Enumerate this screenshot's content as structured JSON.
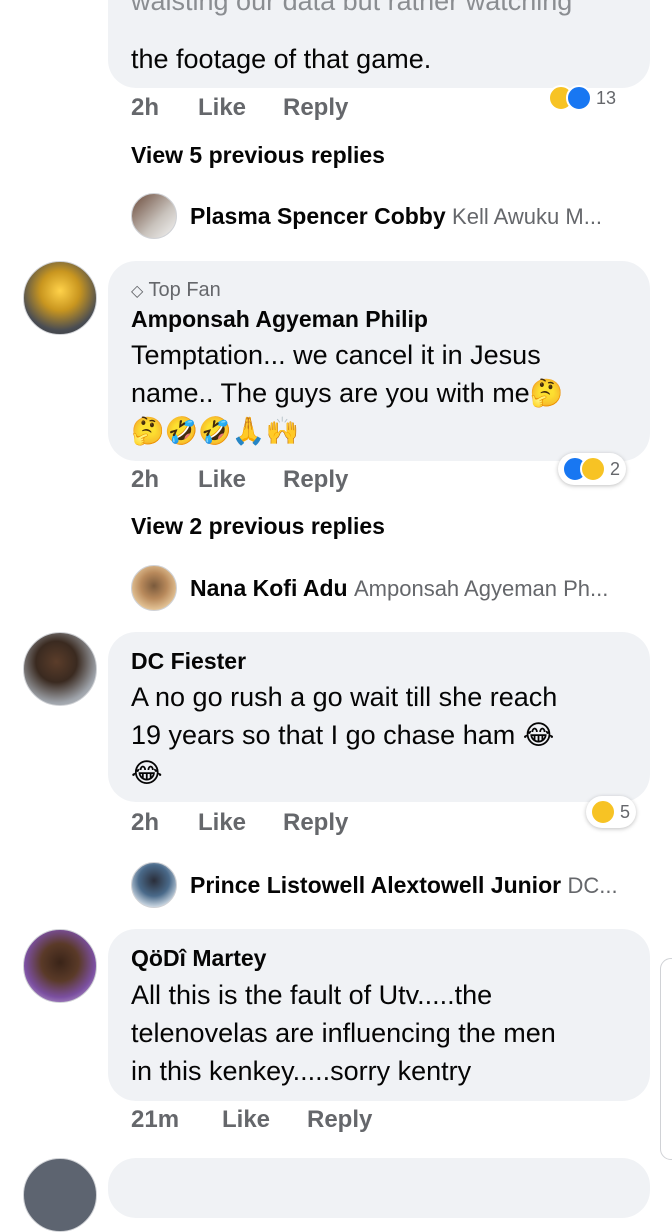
{
  "comments_top": {
    "text_fragment_1": "waisting our data but rather watching",
    "text_fragment_2": "the footage of that game.",
    "time": "2h",
    "like_label": "Like",
    "reply_label": "Reply",
    "reaction_count": "13",
    "view_replies": "View 5 previous replies",
    "latest_reply": {
      "name": "Plasma Spencer Cobby",
      "to": "Kell Awuku M..."
    }
  },
  "comment1": {
    "badge": "Top Fan",
    "author": "Amponsah Agyeman Philip",
    "line1": "Temptation... we cancel it in Jesus",
    "line2": "name.. The guys are you with me🤔",
    "line3": "🤔🤣🤣🙏🙌",
    "time": "2h",
    "like_label": "Like",
    "reply_label": "Reply",
    "reaction_count": "2",
    "view_replies": "View 2 previous replies",
    "latest_reply": {
      "name": "Nana Kofi Adu",
      "to": "Amponsah Agyeman Ph..."
    }
  },
  "comment2": {
    "author": "DC Fiester",
    "line1": "A no go rush a go wait till she reach",
    "line2": "19 years so that I go chase ham 😂",
    "line3": "😂",
    "time": "2h",
    "like_label": "Like",
    "reply_label": "Reply",
    "reaction_count": "5",
    "latest_reply": {
      "name": "Prince Listowell Alextowell Junior",
      "to": "DC..."
    }
  },
  "comment3": {
    "author": "QöDî Martey",
    "line1": "All this is the fault of Utv.....the",
    "line2": "telenovelas are influencing the men",
    "line3": "in this kenkey.....sorry kentry",
    "time": "21m",
    "like_label": "Like",
    "reply_label": "Reply"
  },
  "colors": {
    "bubble": "#f0f2f5",
    "meta": "#65676b",
    "like_blue": "#1877f2",
    "haha_yellow": "#f7c324"
  }
}
